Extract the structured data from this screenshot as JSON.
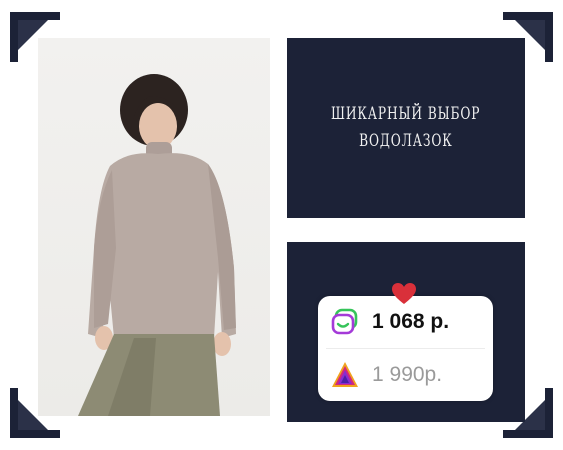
{
  "headline": {
    "line1": "ШИКАРНЫЙ ВЫБОР",
    "line2": "ВОДОЛАЗОК"
  },
  "prices": {
    "main": "1 068 р.",
    "alt": "1 990р."
  },
  "icons": {
    "store_main": "chat-logo-icon",
    "store_alt": "triangle-logo-icon",
    "favorite": "heart-icon"
  },
  "colors": {
    "panel": "#1c2237",
    "heart": "#d9303a"
  }
}
